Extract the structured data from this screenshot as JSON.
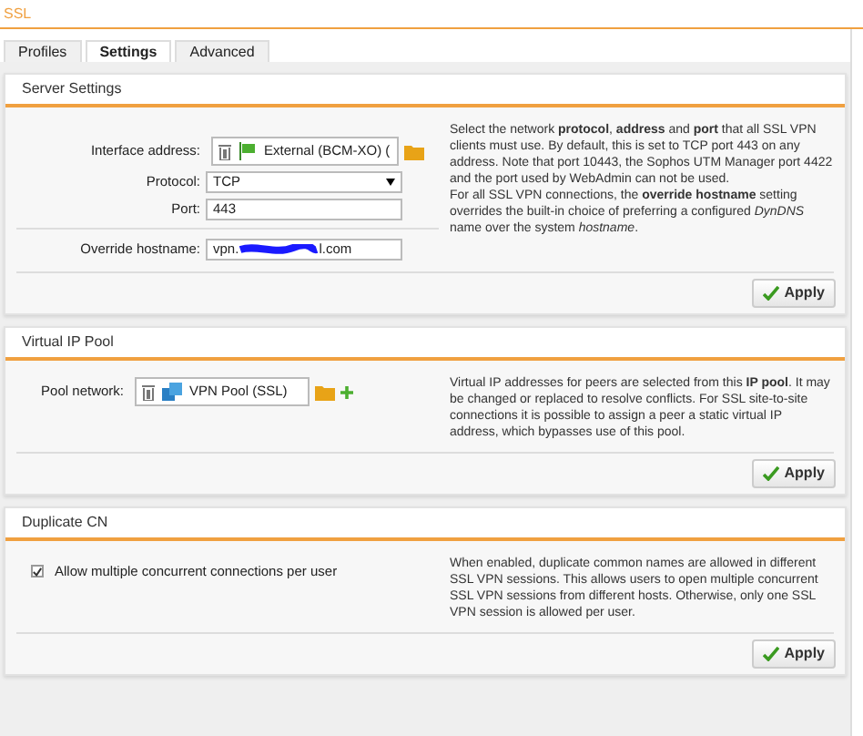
{
  "window": {
    "title": "SSL"
  },
  "tabs": [
    {
      "label": "Profiles",
      "selected": false
    },
    {
      "label": "Settings",
      "selected": true
    },
    {
      "label": "Advanced",
      "selected": false
    }
  ],
  "sections": [
    {
      "title": "Server Settings",
      "fields": [
        {
          "kind": "object",
          "label": "Interface address:",
          "value": "External (BCM-XO) (",
          "add": false
        },
        {
          "kind": "select",
          "label": "Protocol:",
          "value": "TCP"
        },
        {
          "kind": "text",
          "label": "Port:",
          "value": "443"
        },
        {
          "kind": "redacted",
          "label": "Override hostname:",
          "value": "vpn.",
          "value_end": "l.com"
        }
      ],
      "description": "Select the network **protocol**, **address** and **port** that all SSL VPN clients must use. By default, this is set to TCP port 443 on any address. Note that port 10443, the Sophos UTM Manager port 4422 and the port used by WebAdmin can not be used.\nFor all SSL VPN connections, the **override hostname** setting overrides the built-in choice of preferring a configured *DynDNS* name over the system *hostname*.",
      "button": "Apply"
    },
    {
      "title": "Virtual IP Pool",
      "fields": [
        {
          "kind": "object",
          "label": "Pool network:",
          "value": "VPN Pool (SSL)",
          "add": true
        }
      ],
      "description": "Virtual IP addresses for peers are selected from this **IP pool**. It may be changed or replaced to resolve conflicts. For SSL site-to-site connections it is possible to assign a peer a static virtual IP address, which bypasses use of this pool.",
      "button": "Apply"
    },
    {
      "title": "Duplicate CN",
      "fields": [
        {
          "kind": "checkbox",
          "label": "Allow multiple concurrent connections per user",
          "checked": true
        }
      ],
      "description": "When enabled, duplicate common names are allowed in different SSL VPN sessions. This allows users to open multiple concurrent SSL VPN sessions from different hosts. Otherwise, only one SSL VPN session is allowed per user.",
      "button": "Apply"
    }
  ]
}
